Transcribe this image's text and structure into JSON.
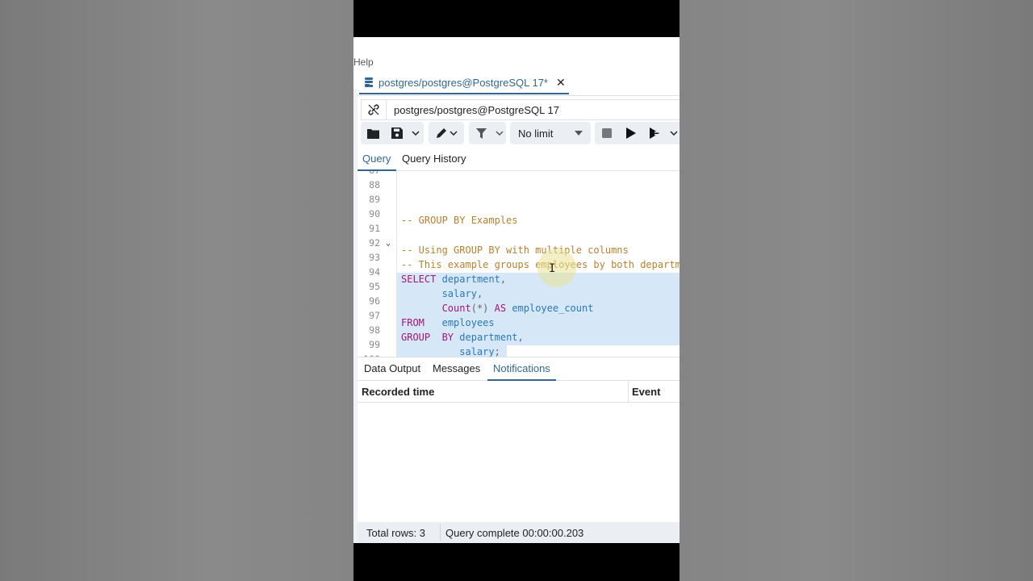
{
  "menubar": {
    "help": "Help"
  },
  "query_tab": {
    "label": "postgres/postgres@PostgreSQL 17*",
    "close": "✕"
  },
  "connection": {
    "label": "postgres/postgres@PostgreSQL 17"
  },
  "toolbar": {
    "limit": "No limit"
  },
  "editor_tabs": {
    "query": "Query",
    "history": "Query History"
  },
  "editor": {
    "lines": [
      {
        "num": "87",
        "text": ""
      },
      {
        "num": "88",
        "text": "-- GROUP BY Examples"
      },
      {
        "num": "89",
        "text": ""
      },
      {
        "num": "90",
        "text": "-- Using GROUP BY with multiple columns"
      },
      {
        "num": "91",
        "text": "-- This example groups employees by both department and salary"
      },
      {
        "num": "92",
        "text": "SELECT department,"
      },
      {
        "num": "93",
        "text": "       salary,"
      },
      {
        "num": "94",
        "text": "       Count(*) AS employee_count"
      },
      {
        "num": "95",
        "text": "FROM   employees"
      },
      {
        "num": "96",
        "text": "GROUP  BY department,"
      },
      {
        "num": "97",
        "text": "          salary;"
      },
      {
        "num": "98",
        "text": ""
      },
      {
        "num": "99",
        "text": ""
      },
      {
        "num": "100",
        "text": ""
      }
    ],
    "tokens": {
      "c88": "-- GROUP BY Examples",
      "c90": "-- Using GROUP BY with multiple columns",
      "c91": "-- This example groups employees by both department and salary",
      "select": "SELECT",
      "department": "department",
      "comma": ",",
      "salary": "salary",
      "count": "Count",
      "star": "(*)",
      "as": "AS",
      "alias": "employee_count",
      "from": "FROM",
      "employees": "employees",
      "group": "GROUP",
      "by": "BY",
      "semicolon": ";"
    }
  },
  "result_tabs": {
    "data": "Data Output",
    "messages": "Messages",
    "notifications": "Notifications"
  },
  "grid": {
    "col1": "Recorded time",
    "col2": "Event"
  },
  "status": {
    "rows": "Total rows: 3",
    "complete": "Query complete 00:00:00.203"
  },
  "colors": {
    "accent": "#326690",
    "selection": "#d6e8f7",
    "comment": "#b8812f",
    "keyword": "#a3147a",
    "identifier": "#2b78b5"
  }
}
